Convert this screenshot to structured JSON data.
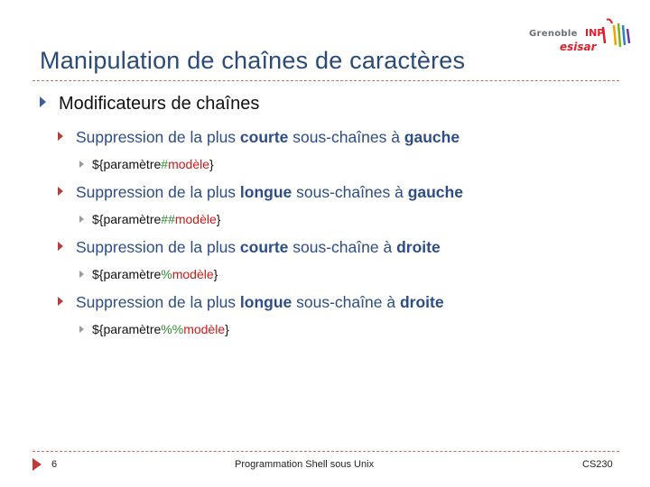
{
  "slide": {
    "title": "Manipulation de chaînes de caractères",
    "logo": {
      "city": "Grenoble",
      "inp": "INP",
      "school": "esisar"
    },
    "heading": "Modificateurs de chaînes",
    "items": [
      {
        "prefix": "Suppression de la plus ",
        "b1": "courte",
        "mid": " sous-chaînes à ",
        "b2": "gauche",
        "example": {
          "open": "${paramètre",
          "op": "#",
          "pattern": "modèle",
          "close": "}"
        }
      },
      {
        "prefix": "Suppression de la plus ",
        "b1": "longue",
        "mid": " sous-chaînes à ",
        "b2": "gauche",
        "example": {
          "open": "${paramètre",
          "op": "##",
          "pattern": "modèle",
          "close": "}"
        }
      },
      {
        "prefix": "Suppression de la plus ",
        "b1": "courte",
        "mid": " sous-chaîne à ",
        "b2": "droite",
        "example": {
          "open": "${paramètre",
          "op": "%",
          "pattern": "modèle",
          "close": "}"
        }
      },
      {
        "prefix": "Suppression de la plus ",
        "b1": "longue",
        "mid": " sous-chaîne à ",
        "b2": "droite",
        "example": {
          "open": "${paramètre",
          "op": "%%",
          "pattern": "modèle",
          "close": "}"
        }
      }
    ],
    "footer": {
      "page": "6",
      "center": "Programmation Shell sous Unix",
      "course": "CS230"
    }
  },
  "colors": {
    "title": "#2a4a78",
    "item": "#2c4d87",
    "operator": "#2e8b2e",
    "pattern": "#d01818",
    "logo_red": "#e01f2a"
  }
}
